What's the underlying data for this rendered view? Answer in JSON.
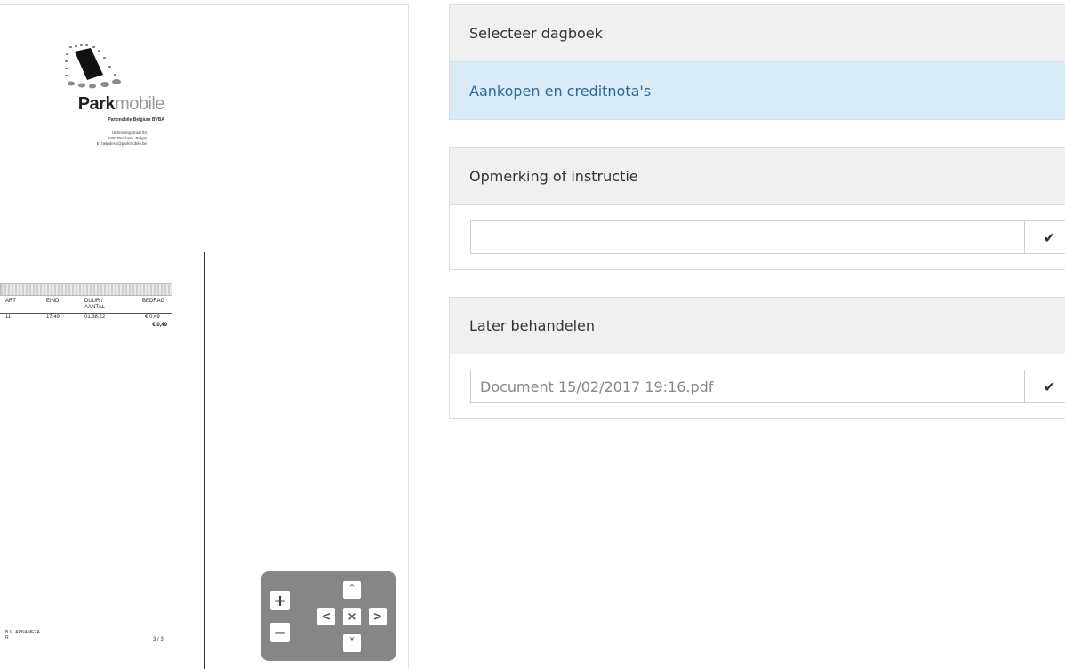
{
  "document_preview": {
    "logo": {
      "brand_bold": "Park",
      "brand_light": "mobile"
    },
    "company_name": "Parkmobile Belgium BVBA",
    "address_line1": "Uitbreidingstraat 84",
    "address_line2": "2600 Berchem, België",
    "address_line3": "E: helpdesk@parkmobile.be",
    "table": {
      "headers": [
        "ART",
        "EIND",
        "DUUR /\nAANTAL",
        "BEDRAG"
      ],
      "row": [
        "11",
        "17:49",
        "01:38:22",
        "€ 0,49"
      ],
      "total": "€ 0,49"
    },
    "footer_left_line1": "B.G. ARNAMEZA",
    "footer_left_line2": "R",
    "page_indicator": "3 / 3"
  },
  "viewer_controls": {
    "zoom_in": "+",
    "zoom_out": "−",
    "pan_up": "˄",
    "pan_down": "˅",
    "pan_left": "<",
    "pan_right": ">",
    "reset": "×"
  },
  "journal_panel": {
    "heading": "Selecteer dagboek",
    "selected": "Aankopen en creditnota's"
  },
  "remark_panel": {
    "heading": "Opmerking of instructie",
    "input_value": "",
    "confirm_icon": "✔"
  },
  "later_panel": {
    "heading": "Later behandelen",
    "input_value": "Document 15/02/2017 19:16.pdf",
    "confirm_icon": "✔"
  }
}
